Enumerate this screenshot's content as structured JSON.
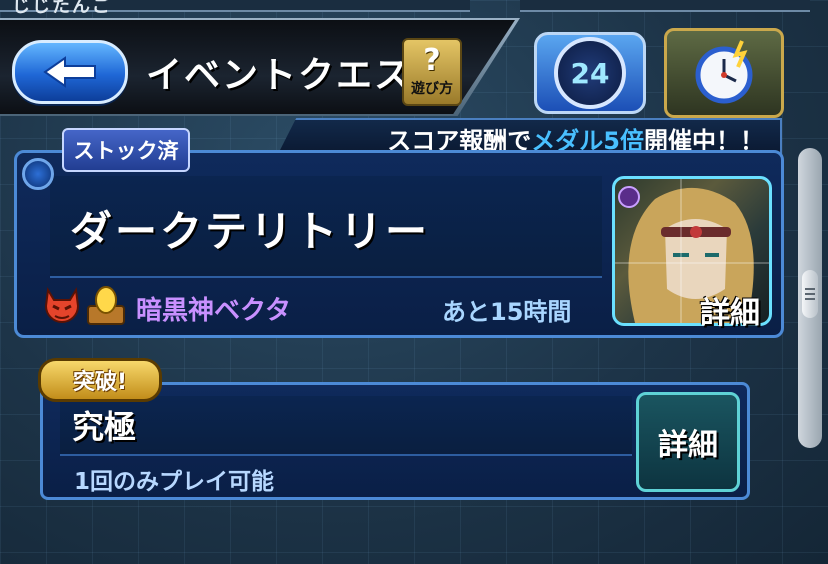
{
  "top_strip": {
    "partial_text": "じじたんご"
  },
  "header": {
    "back_label": "",
    "title": "イベントクエスト",
    "howto_mark": "?",
    "howto_label": "遊び方",
    "stamina_value": "24",
    "clock_icon": "alarm-clock-icon"
  },
  "campaign": {
    "prefix": "スコア報酬で",
    "highlight": "メダル5倍",
    "suffix": "開催中！！"
  },
  "quest1": {
    "stock_label": "ストック済",
    "name": "ダークテリトリー",
    "boss_name": "暗黒神ベクタ",
    "time_left": "あと15時間",
    "detail_label": "詳細"
  },
  "quest2": {
    "badge": "突破!",
    "difficulty": "究極",
    "play_limit": "1回のみプレイ可能",
    "detail_label": "詳細"
  },
  "colors": {
    "accent_blue": "#4c8ad6",
    "highlight_text": "#49c0ff",
    "boss_name": "#c890ff"
  }
}
